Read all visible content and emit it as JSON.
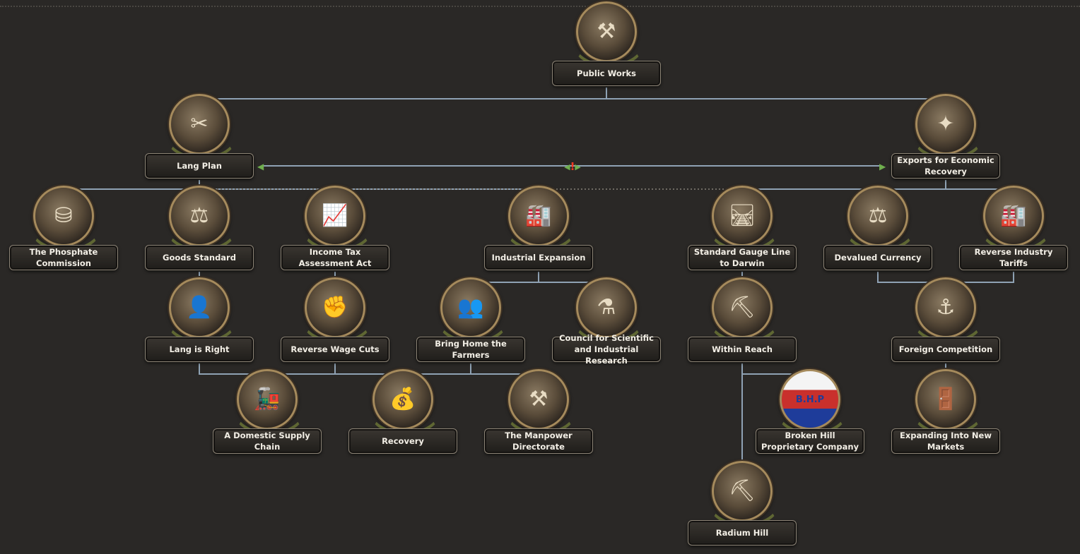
{
  "focus_tree": {
    "nodes": [
      {
        "id": "public_works",
        "label": "Public Works",
        "icon": "hammer-wrench-icon",
        "glyph": "⚒"
      },
      {
        "id": "lang_plan",
        "label": "Lang Plan",
        "icon": "scissors-money-icon",
        "glyph": "✂"
      },
      {
        "id": "exports",
        "label": "Exports for Economic Recovery",
        "icon": "export-arrows-icon",
        "glyph": "✦"
      },
      {
        "id": "phosphate",
        "label": "The Phosphate Commission",
        "icon": "fertilizer-sacks-icon",
        "glyph": "⛁"
      },
      {
        "id": "goods_standard",
        "label": "Goods Standard",
        "icon": "scales-icon",
        "glyph": "⚖"
      },
      {
        "id": "income_tax",
        "label": "Income Tax Assessment Act",
        "icon": "coins-chart-icon",
        "glyph": "📈"
      },
      {
        "id": "industrial_expansion",
        "label": "Industrial Expansion",
        "icon": "factory-icon",
        "glyph": "🏭"
      },
      {
        "id": "standard_gauge",
        "label": "Standard Gauge Line to Darwin",
        "icon": "railway-icon",
        "glyph": "🛤"
      },
      {
        "id": "devalued_currency",
        "label": "Devalued Currency",
        "icon": "scales-gold-icon",
        "glyph": "⚖"
      },
      {
        "id": "reverse_tariffs",
        "label": "Reverse Industry Tariffs",
        "icon": "industry-buildings-icon",
        "glyph": "🏭"
      },
      {
        "id": "lang_is_right",
        "label": "Lang is Right",
        "icon": "portrait-icon",
        "glyph": "👤"
      },
      {
        "id": "reverse_wage",
        "label": "Reverse Wage Cuts",
        "icon": "fist-money-icon",
        "glyph": "✊"
      },
      {
        "id": "farmers",
        "label": "Bring Home the Farmers",
        "icon": "farmers-crowd-icon",
        "glyph": "👥"
      },
      {
        "id": "council",
        "label": "Council for Scientific and Industrial Research",
        "icon": "chalkboard-flask-icon",
        "glyph": "⚗"
      },
      {
        "id": "within_reach",
        "label": "Within Reach",
        "icon": "pickaxe-ore-icon",
        "glyph": "⛏"
      },
      {
        "id": "foreign_competition",
        "label": "Foreign Competition",
        "icon": "ship-cargo-icon",
        "glyph": "⚓"
      },
      {
        "id": "domestic_supply",
        "label": "A Domestic Supply Chain",
        "icon": "train-cargo-icon",
        "glyph": "🚂"
      },
      {
        "id": "recovery",
        "label": "Recovery",
        "icon": "coin-stacks-chart-icon",
        "glyph": "💰"
      },
      {
        "id": "manpower",
        "label": "The Manpower Directorate",
        "icon": "workers-tools-icon",
        "glyph": "⚒"
      },
      {
        "id": "bhp",
        "label": "Broken Hill Proprietary Company",
        "icon": "bhp-logo-icon",
        "glyph": "B.H.P"
      },
      {
        "id": "expanding_markets",
        "label": "Expanding Into New Markets",
        "icon": "open-doors-icon",
        "glyph": "🚪"
      },
      {
        "id": "radium_hill",
        "label": "Radium Hill",
        "icon": "pickaxe-radium-icon",
        "glyph": "⛏"
      }
    ],
    "mutually_exclusive_marker": "!"
  }
}
